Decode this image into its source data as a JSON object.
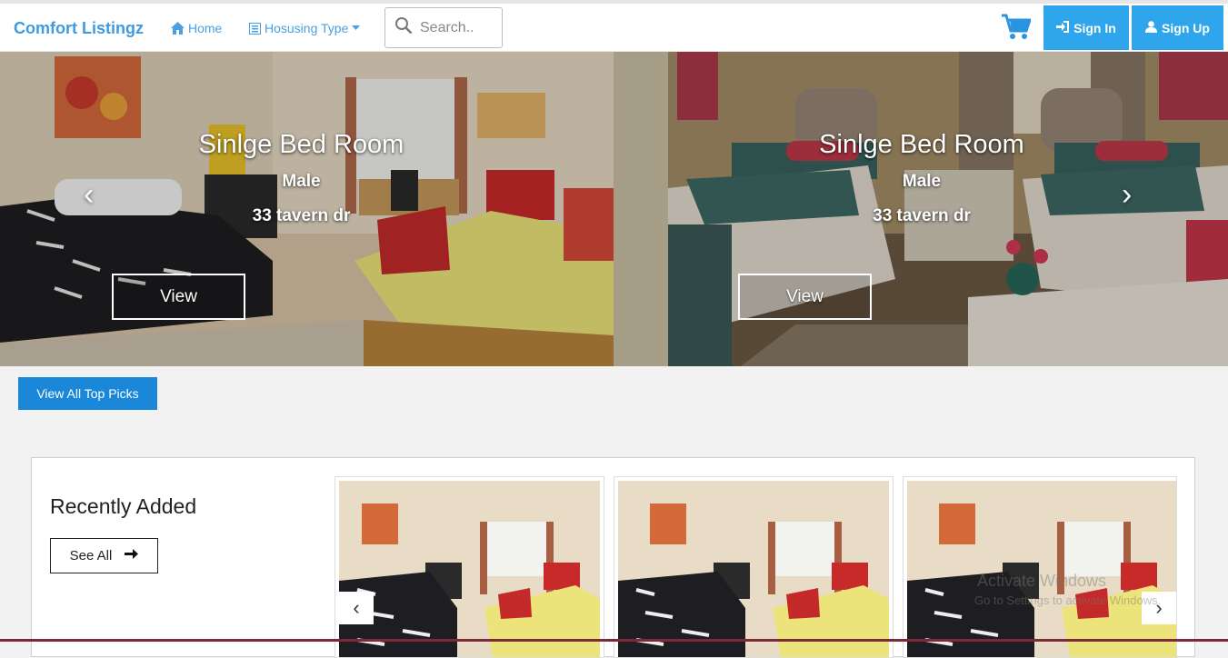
{
  "brand": "Comfort Listingz",
  "nav": {
    "home_label": "Home",
    "housing_label": "Hosusing Type",
    "search_placeholder": "Search..",
    "signin_label": "Sign In",
    "signup_label": "Sign Up"
  },
  "hero": {
    "slides": [
      {
        "title": "Sinlge Bed Room",
        "gender": "Male",
        "address": "33 tavern dr",
        "button": "View"
      },
      {
        "title": "Sinlge Bed Room",
        "gender": "Male",
        "address": "33 tavern dr",
        "button": "View"
      }
    ],
    "prev": "‹",
    "next": "›"
  },
  "top_picks_label": "View All Top Picks",
  "recent": {
    "title": "Recently Added",
    "see_all": "See All",
    "prev": "‹",
    "next": "›"
  },
  "watermark": {
    "line1": "Activate Windows",
    "line2": "Go to Settings to activate Windows."
  },
  "colors": {
    "brand": "#3d9be0",
    "button_blue": "#2fa6ec",
    "top_picks_blue": "#1a87d9"
  },
  "icons": [
    "home-icon",
    "list-icon",
    "caret-down-icon",
    "search-icon",
    "cart-icon",
    "sign-in-icon",
    "user-icon",
    "arrow-right-icon"
  ]
}
